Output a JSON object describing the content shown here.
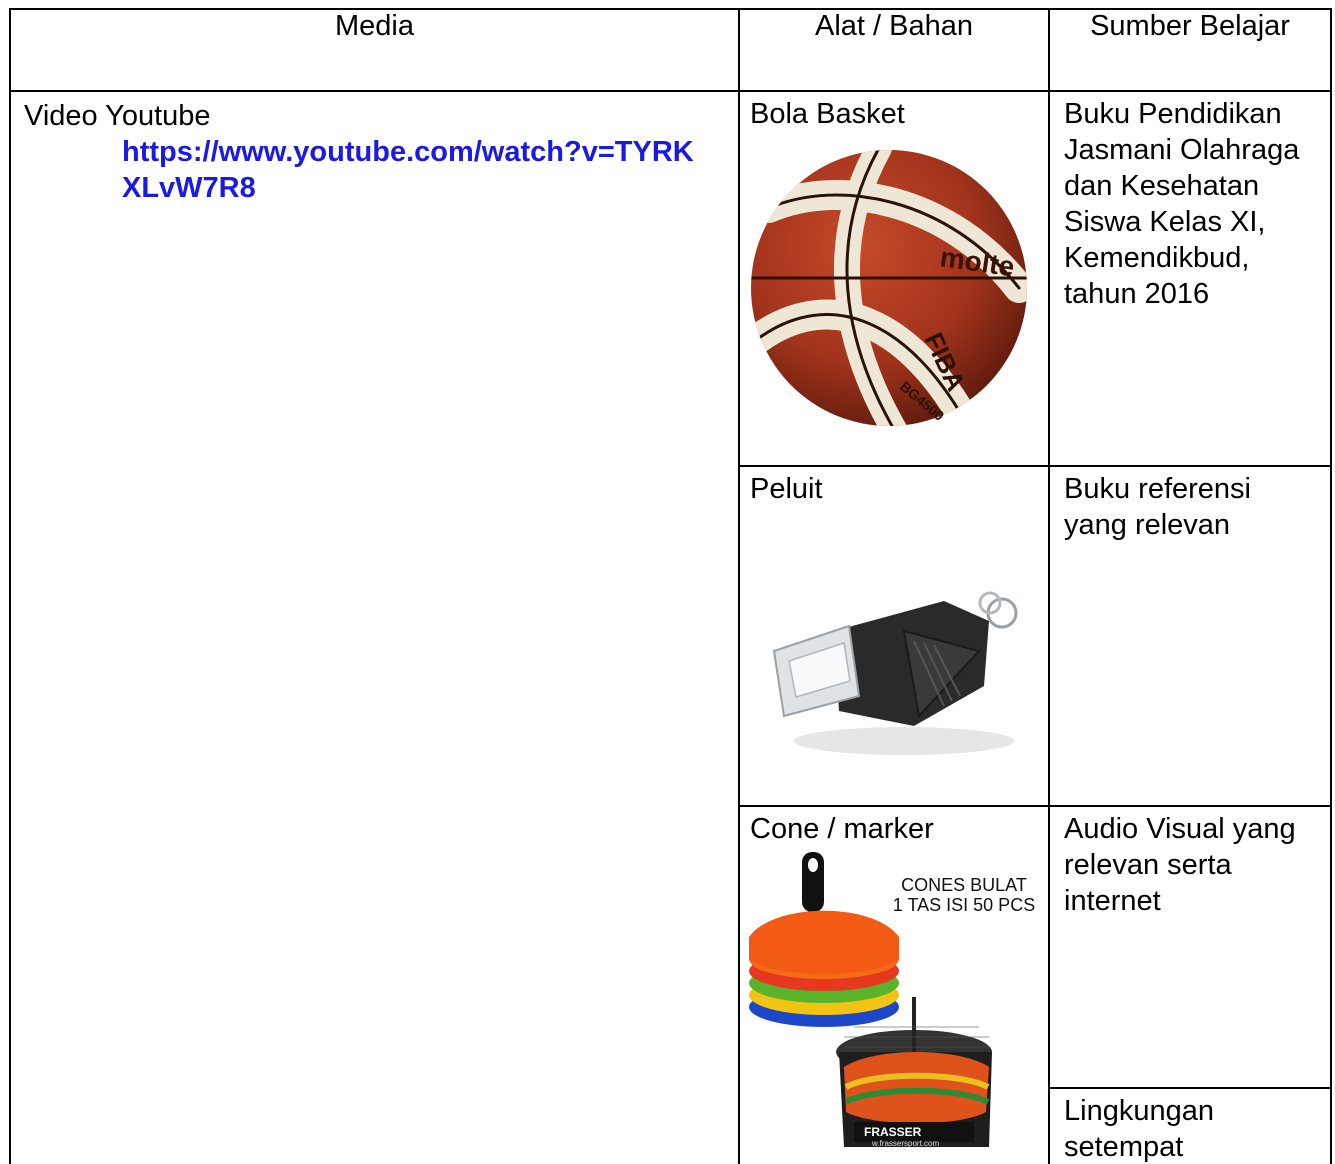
{
  "table": {
    "headers": {
      "media": "Media",
      "alat": "Alat / Bahan",
      "sumber": "Sumber Belajar"
    },
    "media": {
      "title": "Video Youtube",
      "link": "https://www.youtube.com/watch?v=TYRKXLvW7R8"
    },
    "alat": [
      {
        "label": "Bola Basket",
        "image": "basketball-image"
      },
      {
        "label": "Peluit",
        "image": "whistle-image"
      },
      {
        "label": "Cone / marker",
        "image": "cones-image",
        "caption_line1": "CONES BULAT",
        "caption_line2": "1 TAS ISI 50 PCS",
        "brand": "FRASSER",
        "brand_url": "w.frassersport.com"
      }
    ],
    "basketball_marks": {
      "brand": "molte",
      "badge": "FIBA",
      "model": "BG4500"
    },
    "sumber": [
      "Buku Pendidikan Jasmani Olahraga dan Kesehatan Siswa Kelas XI, Kemendikbud, tahun 2016",
      "Buku referensi yang relevan",
      "Audio Visual yang relevan serta internet",
      "Lingkungan setempat"
    ]
  }
}
